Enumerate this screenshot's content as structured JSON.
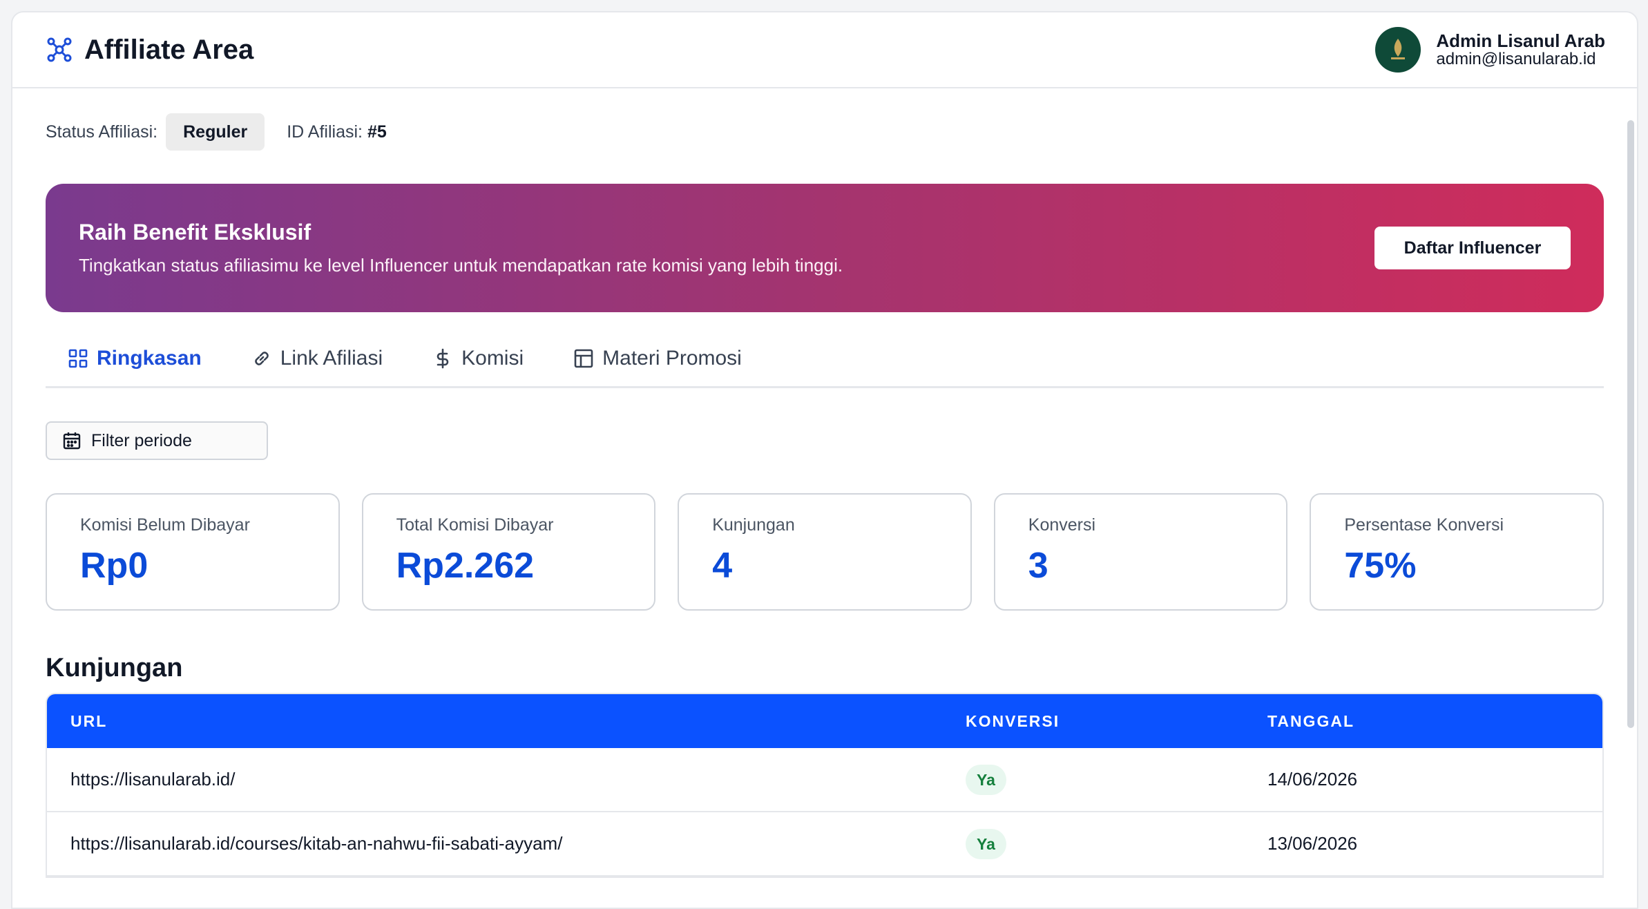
{
  "header": {
    "title": "Affiliate Area",
    "user_name": "Admin Lisanul Arab",
    "user_email": "admin@lisanularab.id"
  },
  "status": {
    "label": "Status Affiliasi:",
    "badge": "Reguler",
    "id_label": "ID Afiliasi:",
    "id_value": "#5"
  },
  "banner": {
    "title": "Raih Benefit Eksklusif",
    "description": "Tingkatkan status afiliasimu ke level Influencer untuk mendapatkan rate komisi yang lebih tinggi.",
    "button": "Daftar Influencer",
    "gradient_start": "#7a3a8e",
    "gradient_end": "#cf2c5b"
  },
  "tabs": [
    {
      "label": "Ringkasan",
      "icon": "grid-icon",
      "active": true
    },
    {
      "label": "Link Afiliasi",
      "icon": "link-icon",
      "active": false
    },
    {
      "label": "Komisi",
      "icon": "dollar-icon",
      "active": false
    },
    {
      "label": "Materi Promosi",
      "icon": "layout-icon",
      "active": false
    }
  ],
  "filter": {
    "label": "Filter periode"
  },
  "stats": [
    {
      "label": "Komisi Belum Dibayar",
      "value": "Rp0"
    },
    {
      "label": "Total Komisi Dibayar",
      "value": "Rp2.262"
    },
    {
      "label": "Kunjungan",
      "value": "4"
    },
    {
      "label": "Konversi",
      "value": "3"
    },
    {
      "label": "Persentase Konversi",
      "value": "75%"
    }
  ],
  "visits": {
    "title": "Kunjungan",
    "columns": [
      "URL",
      "KONVERSI",
      "TANGGAL"
    ],
    "rows": [
      {
        "url": "https://lisanularab.id/",
        "konversi": "Ya",
        "tanggal": "14/06/2026"
      },
      {
        "url": "https://lisanularab.id/courses/kitab-an-nahwu-fii-sabati-ayyam/",
        "konversi": "Ya",
        "tanggal": "13/06/2026"
      }
    ]
  },
  "colors": {
    "accent": "#0b52ff",
    "stat_value": "#0b4bd8",
    "active_tab": "#1d4ed8"
  }
}
